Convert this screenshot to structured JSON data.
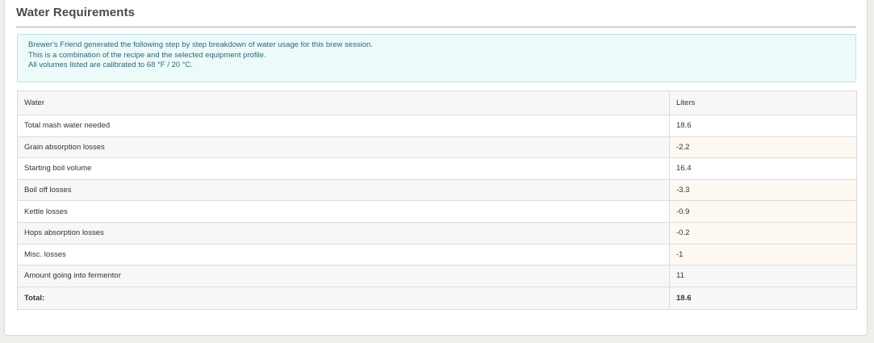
{
  "section": {
    "title": "Water Requirements"
  },
  "info": {
    "lines": [
      "Brewer's Friend generated the following step by step breakdown of water usage for this brew session.",
      "This is a combination of the recipe and the selected equipment profile.",
      "All volumes listed are calibrated to 68 °F / 20 °C."
    ]
  },
  "table": {
    "headers": [
      "Water",
      "Liters"
    ],
    "rows": [
      {
        "label": "Total mash water needed",
        "value": "18.6"
      },
      {
        "label": "Grain absorption losses",
        "value": "-2.2"
      },
      {
        "label": "Starting boil volume",
        "value": "16.4"
      },
      {
        "label": "Boil off losses",
        "value": "-3.3"
      },
      {
        "label": "Kettle losses",
        "value": "-0.9"
      },
      {
        "label": "Hops absorption losses",
        "value": "-0.2"
      },
      {
        "label": "Misc. losses",
        "value": "-1"
      },
      {
        "label": "Amount going into fermentor",
        "value": "11"
      }
    ],
    "total": {
      "label": "Total:",
      "value": "18.6"
    }
  },
  "colors": {
    "info_background": "#edfafa",
    "info_text": "#2e6777",
    "loss_highlight": "#fdf8f1"
  }
}
